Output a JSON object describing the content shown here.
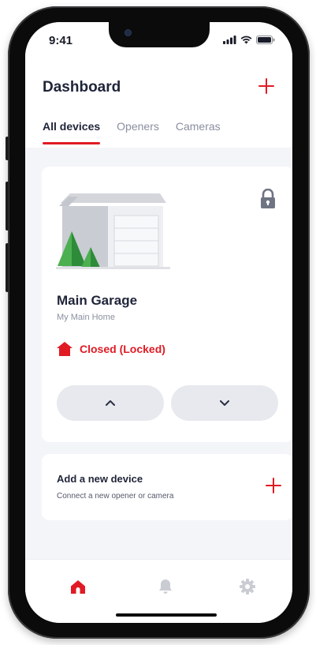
{
  "status_bar": {
    "time": "9:41"
  },
  "header": {
    "title": "Dashboard",
    "add_icon": "plus-icon"
  },
  "tabs": [
    {
      "label": "All devices",
      "active": true
    },
    {
      "label": "Openers",
      "active": false
    },
    {
      "label": "Cameras",
      "active": false
    }
  ],
  "device": {
    "name": "Main Garage",
    "location": "My Main Home",
    "status": "Closed (Locked)",
    "lock_icon": "lock-icon",
    "open_icon": "chevron-up-icon",
    "close_icon": "chevron-down-icon"
  },
  "add_device": {
    "title": "Add a new device",
    "subtitle": "Connect a new opener or camera"
  },
  "bottom_nav": [
    {
      "icon": "home-icon",
      "active": true
    },
    {
      "icon": "bell-icon",
      "active": false
    },
    {
      "icon": "gear-icon",
      "active": false
    }
  ],
  "colors": {
    "accent": "#e01b24",
    "text": "#1f2438",
    "muted": "#8a8fa0",
    "background": "#f4f5f8"
  }
}
